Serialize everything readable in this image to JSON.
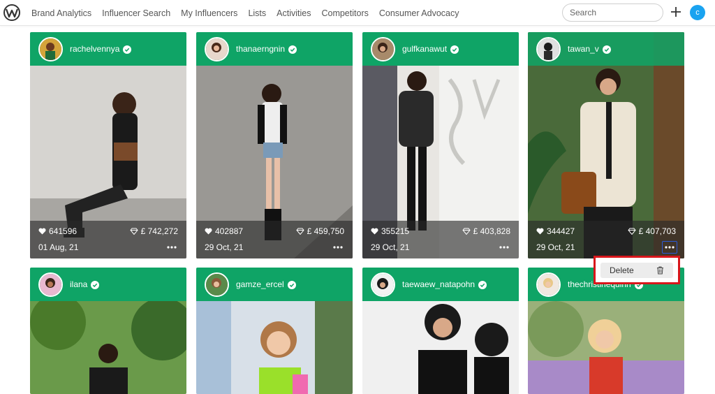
{
  "nav": {
    "items": [
      "Brand Analytics",
      "Influencer Search",
      "My Influencers",
      "Lists",
      "Activities",
      "Competitors",
      "Consumer Advocacy"
    ],
    "search_placeholder": "Search",
    "user_initial": "C"
  },
  "icons": {
    "logo": "logo-icon",
    "add": "plus-icon",
    "verified": "verified-badge-icon",
    "likes": "heart-icon",
    "value": "diamond-icon",
    "more": "more-dots-icon",
    "delete": "trash-icon"
  },
  "colors": {
    "header_green": "#0fa466",
    "avatar_blue": "#1aa3f0",
    "highlight_red": "#d8161b"
  },
  "cards": [
    {
      "username": "rachelvennya",
      "likes": "641596",
      "value": "£ 742,272",
      "date": "01 Aug, 21"
    },
    {
      "username": "thanaerngnin",
      "likes": "402887",
      "value": "£ 459,750",
      "date": "29 Oct, 21"
    },
    {
      "username": "gulfkanawut",
      "likes": "355215",
      "value": "£ 403,828",
      "date": "29 Oct, 21"
    },
    {
      "username": "tawan_v",
      "likes": "344427",
      "value": "£ 407,703",
      "date": "29 Oct, 21"
    },
    {
      "username": "ilana"
    },
    {
      "username": "gamze_ercel"
    },
    {
      "username": "taewaew_natapohn"
    },
    {
      "username": "thechristinequinn"
    }
  ],
  "context_menu": {
    "delete_label": "Delete"
  }
}
